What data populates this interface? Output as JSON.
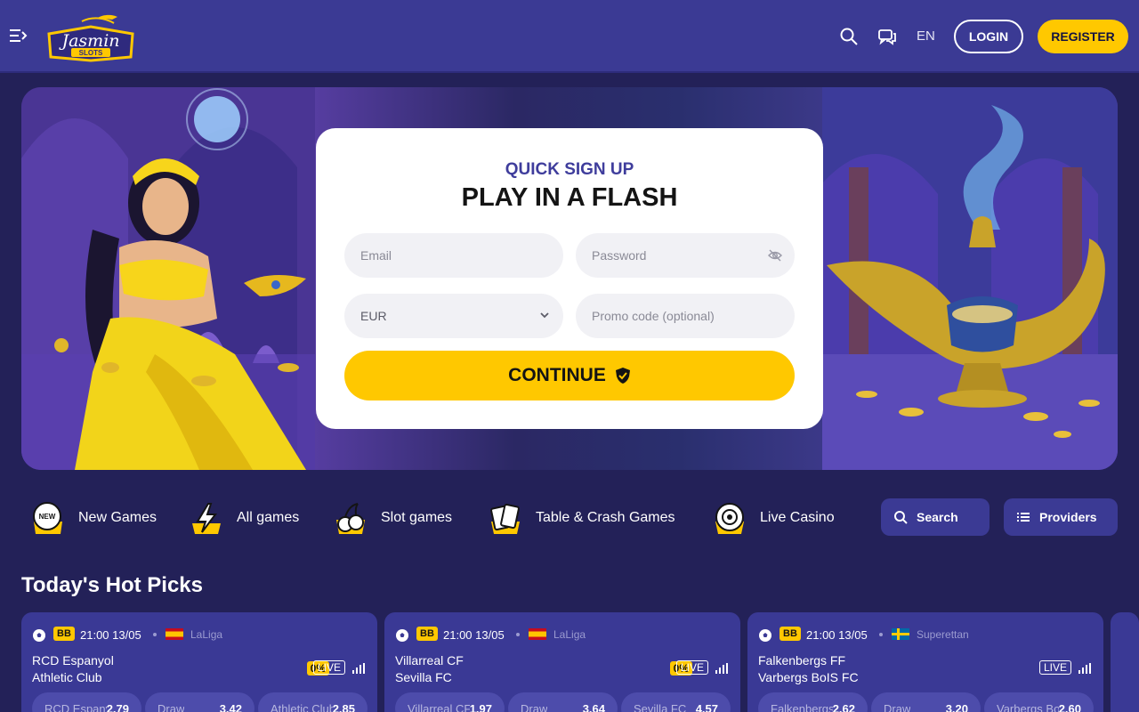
{
  "header": {
    "logo_text": "Jasmin",
    "logo_sub": "SLOTS",
    "lang": "EN",
    "login": "LOGIN",
    "register": "REGISTER",
    "icons": [
      "menu-icon",
      "search-icon",
      "chat-icon"
    ]
  },
  "signup": {
    "subtitle": "QUICK SIGN UP",
    "title": "PLAY IN A FLASH",
    "email_placeholder": "Email",
    "password_placeholder": "Password",
    "currency": "EUR",
    "promo_placeholder": "Promo code (optional)",
    "continue": "CONTINUE"
  },
  "categories": [
    {
      "label": "New Games",
      "icon": "new-badge-icon"
    },
    {
      "label": "All games",
      "icon": "lightning-icon"
    },
    {
      "label": "Slot games",
      "icon": "cherries-icon"
    },
    {
      "label": "Table & Crash Games",
      "icon": "cards-icon"
    },
    {
      "label": "Live Casino",
      "icon": "roulette-icon"
    }
  ],
  "search_label": "Search",
  "providers_label": "Providers",
  "hot_picks": {
    "title": "Today's Hot Picks",
    "matches": [
      {
        "badge": "BB",
        "time": "21:00  13/05",
        "league": "LaLiga",
        "flag": "spain",
        "team1": "RCD Espanyol",
        "team2": "Athletic Club",
        "pct": "0%",
        "live": "LIVE",
        "odds": [
          {
            "name": "RCD Espanyol",
            "value": "2.79"
          },
          {
            "name": "Draw",
            "value": "3.42"
          },
          {
            "name": "Athletic Club",
            "value": "2.85"
          }
        ]
      },
      {
        "badge": "BB",
        "time": "21:00  13/05",
        "league": "LaLiga",
        "flag": "spain",
        "team1": "Villarreal CF",
        "team2": "Sevilla FC",
        "pct": "0%",
        "live": "LIVE",
        "odds": [
          {
            "name": "Villarreal CF",
            "value": "1.97"
          },
          {
            "name": "Draw",
            "value": "3.64"
          },
          {
            "name": "Sevilla FC",
            "value": "4.57"
          }
        ]
      },
      {
        "badge": "BB",
        "time": "21:00  13/05",
        "league": "Superettan",
        "flag": "sweden",
        "team1": "Falkenbergs FF",
        "team2": "Varbergs BoIS FC",
        "pct": "",
        "live": "LIVE",
        "odds": [
          {
            "name": "Falkenbergs FF",
            "value": "2.62"
          },
          {
            "name": "Draw",
            "value": "3.20"
          },
          {
            "name": "Varbergs BoIS FC",
            "value": "2.60"
          }
        ]
      }
    ]
  },
  "colors": {
    "accent": "#ffc800",
    "header": "#3b3a94",
    "background": "#232158",
    "brand_text": "#3f3d9c"
  }
}
